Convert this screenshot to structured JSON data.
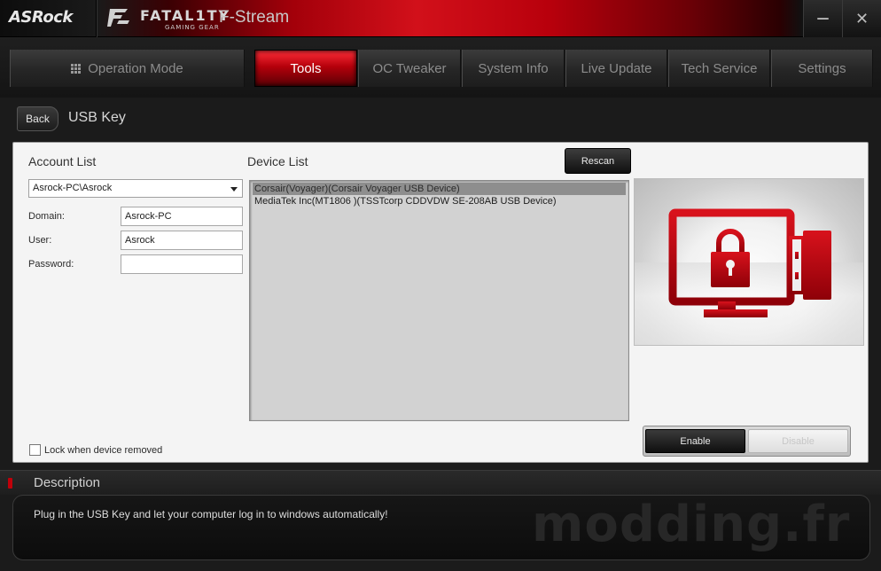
{
  "titlebar": {
    "brand": "ASRock",
    "logo_text": "FATAL1TY",
    "logo_sub": "GAMING GEAR",
    "app_title": "F-Stream",
    "minimize_label": "—",
    "close_label": "✕"
  },
  "nav": {
    "tabs": [
      {
        "label": "Operation Mode",
        "icon": "grid-icon",
        "active": false
      },
      {
        "label": "Tools",
        "active": true
      },
      {
        "label": "OC Tweaker",
        "active": false
      },
      {
        "label": "System Info",
        "active": false
      },
      {
        "label": "Live Update",
        "active": false
      },
      {
        "label": "Tech Service",
        "active": false
      },
      {
        "label": "Settings",
        "active": false
      }
    ]
  },
  "header": {
    "back_label": "Back",
    "page_title": "USB Key"
  },
  "account": {
    "section_title": "Account List",
    "selected_account": "Asrock-PC\\Asrock",
    "domain_label": "Domain:",
    "domain_value": "Asrock-PC",
    "user_label": "User:",
    "user_value": "Asrock",
    "password_label": "Password:",
    "password_value": "",
    "lock_label": "Lock when device removed",
    "lock_checked": false
  },
  "devices": {
    "section_title": "Device List",
    "rescan_label": "Rescan",
    "items": [
      {
        "label": "Corsair(Voyager)(Corsair Voyager USB Device)",
        "selected": true
      },
      {
        "label": "MediaTek Inc(MT1806 )(TSSTcorp CDDVDW SE-208AB USB Device)",
        "selected": false
      }
    ]
  },
  "actions": {
    "enable_label": "Enable",
    "disable_label": "Disable",
    "disable_enabled": false
  },
  "description": {
    "title": "Description",
    "text": "Plug in the USB Key and let your computer log in to windows automatically!",
    "watermark": "modding.fr"
  },
  "colors": {
    "accent": "#c0000a",
    "icon_red": "#c4101a",
    "panel_bg": "#f4f4f4"
  }
}
